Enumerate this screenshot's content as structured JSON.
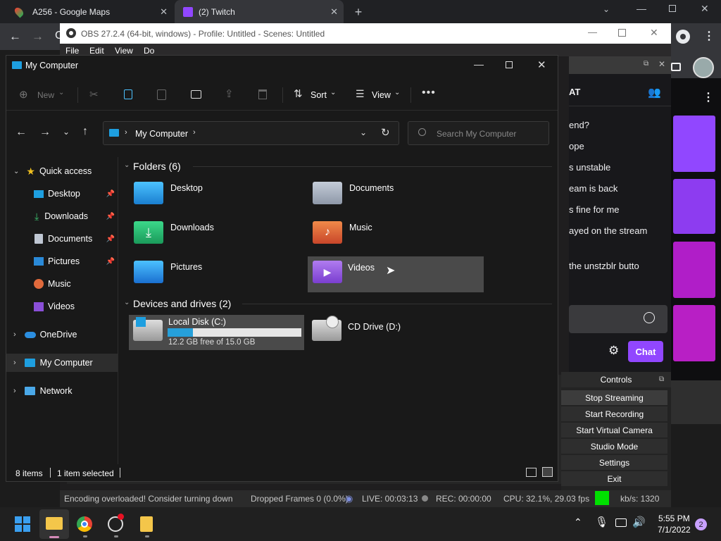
{
  "chrome": {
    "tabs": [
      {
        "title": "A256 - Google Maps"
      },
      {
        "title": "(2) Twitch"
      }
    ],
    "new_tab": "+"
  },
  "obs": {
    "title": "OBS 27.2.4 (64-bit, windows) - Profile: Untitled - Scenes: Untitled",
    "menu": [
      "File",
      "Edit",
      "View",
      "Do"
    ],
    "controls_title": "Controls",
    "controls": [
      "Stop Streaming",
      "Start Recording",
      "Start Virtual Camera",
      "Studio Mode",
      "Settings",
      "Exit"
    ],
    "status": {
      "message": "Encoding overloaded! Consider turning down",
      "dropped": "Dropped Frames 0 (0.0%)",
      "live": "LIVE: 00:03:13",
      "rec": "REC: 00:00:00",
      "cpu": "CPU: 32.1%, 29.03 fps",
      "kbs": "kb/s: 1320",
      "indicator_color": "#00e000"
    }
  },
  "twitch": {
    "header": "AT",
    "chat_lines": [
      "end?",
      "ope",
      "s unstable",
      "eam is back",
      "s fine for me",
      "ayed on the stream",
      "the unstzblr butto"
    ],
    "chat_button": "Chat",
    "accent": "#9147ff"
  },
  "explorer": {
    "title": "My Computer",
    "toolbar": {
      "new": "New",
      "sort": "Sort",
      "view": "View"
    },
    "address": {
      "root": "My Computer"
    },
    "search_placeholder": "Search My Computer",
    "sidebar": {
      "quick_access": "Quick access",
      "items": [
        {
          "label": "Desktop",
          "pinned": true
        },
        {
          "label": "Downloads",
          "pinned": true
        },
        {
          "label": "Documents",
          "pinned": true
        },
        {
          "label": "Pictures",
          "pinned": true
        },
        {
          "label": "Music",
          "pinned": false
        },
        {
          "label": "Videos",
          "pinned": false
        }
      ],
      "onedrive": "OneDrive",
      "my_computer": "My Computer",
      "network": "Network"
    },
    "folders_header": "Folders (6)",
    "folders": [
      "Desktop",
      "Documents",
      "Downloads",
      "Music",
      "Pictures",
      "Videos"
    ],
    "drives_header": "Devices and drives (2)",
    "drives": [
      {
        "name": "Local Disk (C:)",
        "free": "12.2 GB free of 15.0 GB",
        "used_fraction": 0.187
      },
      {
        "name": "CD Drive (D:)"
      }
    ],
    "status": {
      "items": "8 items",
      "selected": "1 item selected"
    }
  },
  "taskbar": {
    "time": "5:55 PM",
    "date": "7/1/2022",
    "notifications": "2"
  }
}
